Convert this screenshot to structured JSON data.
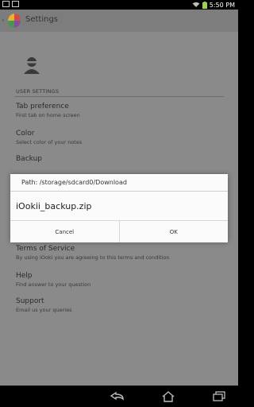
{
  "status_bar": {
    "time": "5:50 PM"
  },
  "action_bar": {
    "title": "Settings"
  },
  "section": {
    "title": "USER SETTINGS"
  },
  "preferences": [
    {
      "title": "Tab preference",
      "summary": "First tab on home screen"
    },
    {
      "title": "Color",
      "summary": "Select color of your notes"
    },
    {
      "title": "Backup",
      "summary": ""
    },
    {
      "title": "Terms of Service",
      "summary": "By using iOoki you are agreeing to this terms and condition"
    },
    {
      "title": "Help",
      "summary": "Find answer to your question"
    },
    {
      "title": "Support",
      "summary": "Email us your queries"
    }
  ],
  "dialog": {
    "title": "Path: /storage/sdcard0/Download",
    "item": "iOokii_backup.zip",
    "cancel_label": "Cancel",
    "ok_label": "OK"
  },
  "icons": {
    "status_left": [
      "image-icon",
      "photo-icon"
    ],
    "status_right": [
      "wifi-icon",
      "battery-icon"
    ],
    "nav": [
      "back-icon",
      "home-icon",
      "recent-apps-icon"
    ]
  }
}
